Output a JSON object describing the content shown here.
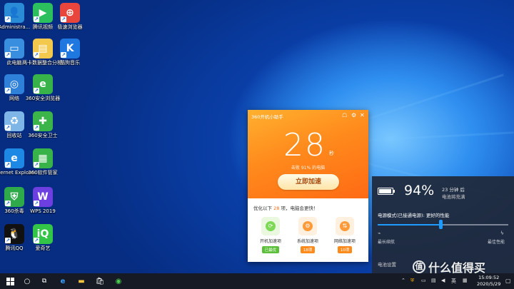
{
  "desktop": {
    "icons": [
      {
        "label": "Administra...",
        "color": "#2a8bd6",
        "glyph": "👤"
      },
      {
        "label": "腾讯视频",
        "color": "#2bbf5d",
        "glyph": "▶"
      },
      {
        "label": "极速浏览器",
        "color": "#e8453c",
        "glyph": "⊕"
      },
      {
        "label": "此电脑",
        "color": "#3a8ee0",
        "glyph": "▭"
      },
      {
        "label": "两卡数据整合分析...",
        "color": "#f2c94c",
        "glyph": "▤"
      },
      {
        "label": "酷狗音乐",
        "color": "#1f77e0",
        "glyph": "K"
      },
      {
        "label": "网络",
        "color": "#2f80d8",
        "glyph": "◎"
      },
      {
        "label": "360安全浏览器",
        "color": "#37b34a",
        "glyph": "e"
      },
      {
        "label": "回收站",
        "color": "#7fb6e8",
        "glyph": "♻"
      },
      {
        "label": "360安全卫士",
        "color": "#3bb54a",
        "glyph": "✚"
      },
      {
        "label": "Internet Explorer",
        "color": "#1e88e5",
        "glyph": "e"
      },
      {
        "label": "360软件管家",
        "color": "#37b34a",
        "glyph": "▦"
      },
      {
        "label": "360杀毒",
        "color": "#2faa4b",
        "glyph": "⛨"
      },
      {
        "label": "WPS 2019",
        "color": "#6d3fe0",
        "glyph": "W"
      },
      {
        "label": "腾讯QQ",
        "color": "#111111",
        "glyph": "🐧"
      },
      {
        "label": "爱奇艺",
        "color": "#33c548",
        "glyph": "iQ"
      }
    ]
  },
  "tool360": {
    "title": "360开机小助手",
    "seconds": "28",
    "unit": "秒",
    "beat_text": "击败 91% 的电脑",
    "boost_button": "立即加速",
    "optimize_prefix": "优化以下",
    "optimize_count": "28",
    "optimize_suffix": "项，电脑会更快！",
    "items": [
      {
        "name": "开机加速项",
        "badge": "已最优",
        "color": "#5cbf3a",
        "icon_color": "#7ed957"
      },
      {
        "name": "系统加速项",
        "badge": "18项",
        "color": "#ff8a1c",
        "icon_color": "#ff9a3a"
      },
      {
        "name": "网络加速项",
        "badge": "10项",
        "color": "#ff8a1c",
        "icon_color": "#ff9a3a"
      }
    ]
  },
  "battery": {
    "percent": "94%",
    "time": "23 分钟 后",
    "state": "电池将充满",
    "mode_label": "电源模式(已接通电源): 更好的性能",
    "left_label": "最长续航",
    "right_label": "最佳性能",
    "slider_level": 0.5,
    "settings": "电池设置"
  },
  "taskbar": {
    "time": "15:09:52",
    "date": "2020/5/29",
    "lang": "英"
  },
  "watermark": {
    "text": "什么值得买",
    "glyph": "值"
  }
}
